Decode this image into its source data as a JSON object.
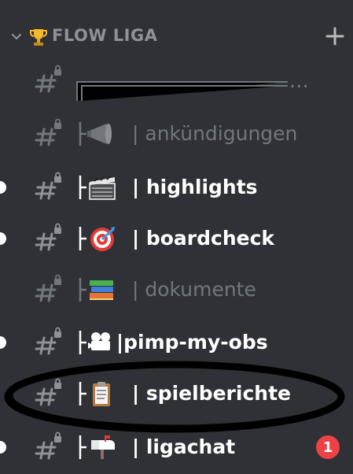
{
  "category": {
    "name": "FLOW LIGA",
    "icons": [
      "chevron-down-icon",
      "trophy-icon",
      "plus-icon"
    ]
  },
  "channels": [
    {
      "label": "",
      "suffix": "...",
      "emoji": "divider-lines",
      "unread": false,
      "muted": true
    },
    {
      "label": "| ankündigungen",
      "emoji": "megaphone-icon",
      "unread": false,
      "muted": true
    },
    {
      "label": "| highlights",
      "emoji": "clapperboard-icon",
      "unread": true,
      "muted": false
    },
    {
      "label": "| boardcheck",
      "emoji": "dart-target-icon",
      "unread": true,
      "muted": false
    },
    {
      "label": "| dokumente",
      "emoji": "books-icon",
      "unread": false,
      "muted": true
    },
    {
      "label": "|pimp-my-obs",
      "emoji": "movie-camera-icon",
      "unread": true,
      "muted": false
    },
    {
      "label": "| spielberichte",
      "emoji": "clipboard-icon",
      "unread": false,
      "muted": false
    },
    {
      "label": "| ligachat",
      "emoji": "mailbox-icon",
      "unread": true,
      "muted": false,
      "badge": "1"
    }
  ],
  "colors": {
    "background": "#2f3136",
    "muted_text": "#72767d",
    "bright_text": "#ffffff",
    "badge": "#ed4245",
    "annotation": "#000000"
  }
}
